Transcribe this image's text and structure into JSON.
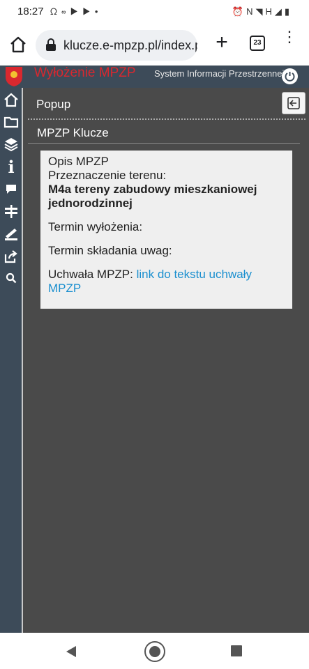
{
  "status_bar": {
    "time": "18:27",
    "left_icons": [
      "wind-icon",
      "link-icon",
      "youtube-icon",
      "youtube-icon",
      "dot-icon"
    ],
    "right_icons": [
      "alarm-icon",
      "nfc-icon",
      "wifi-icon",
      "signal-icon",
      "battery-icon"
    ],
    "network_label": "H"
  },
  "browser": {
    "url": "klucze.e-mpzp.pl/index.p",
    "tab_count": "23"
  },
  "app": {
    "title": "Wyłożenie MPZP",
    "subtitle": "System Informacji Przestrzennej",
    "sidebar_items": [
      "home-icon",
      "folder-icon",
      "layers-icon",
      "info-icon",
      "comment-icon",
      "signpost-icon",
      "ruler-icon",
      "share-icon",
      "search-icon"
    ]
  },
  "popup": {
    "title": "Popup",
    "section_title": "MPZP Klucze",
    "card": {
      "heading": "Opis MPZP",
      "purpose_label": "Przeznaczenie terenu:",
      "purpose_value": "M4a tereny zabudowy mieszkaniowej jednorodzinnej",
      "exhibition_label": "Termin wyłożenia:",
      "comments_label": "Termin składania uwag:",
      "resolution_label": "Uchwała MPZP: ",
      "resolution_link": "link do tekstu uchwały MPZP"
    }
  },
  "colors": {
    "header_bg": "#3d4b59",
    "title_red": "#d9282f",
    "content_bg": "#4a4a4a",
    "card_bg": "#efefef",
    "link_blue": "#1a8fcf"
  }
}
